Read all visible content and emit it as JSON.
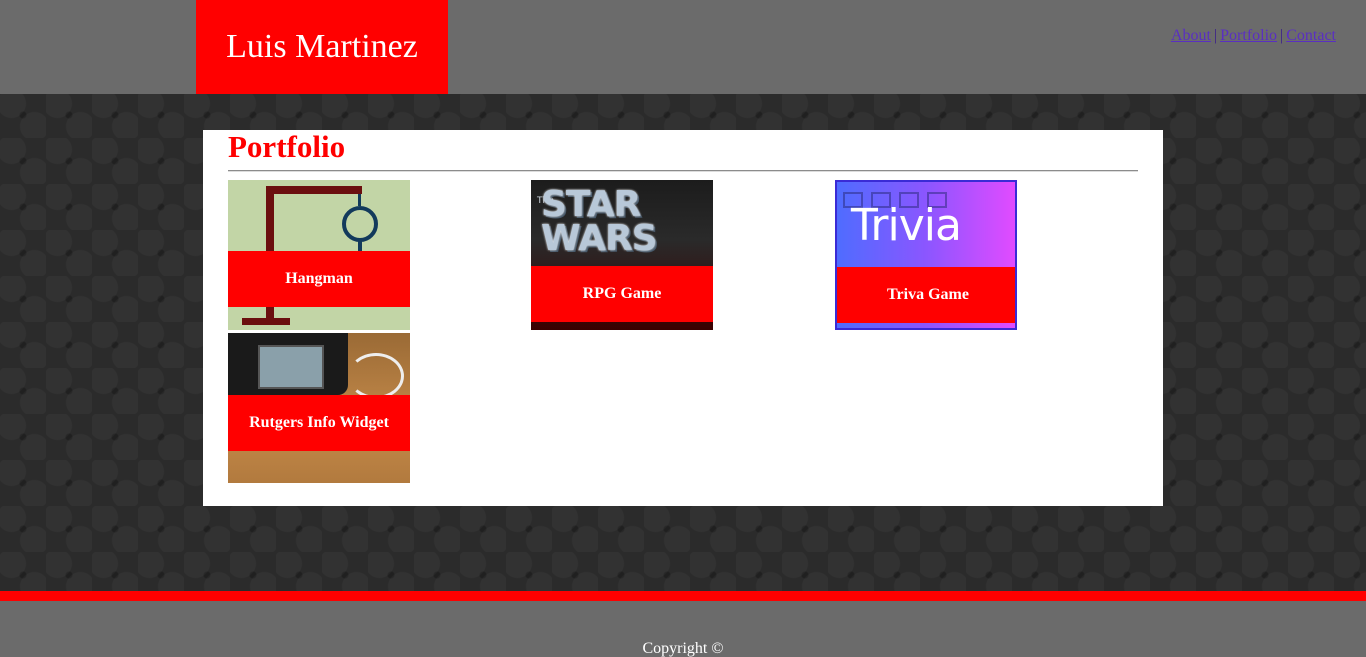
{
  "header": {
    "brand": "Luis Martinez",
    "nav": [
      {
        "label": "About"
      },
      {
        "label": "Portfolio"
      },
      {
        "label": "Contact"
      }
    ],
    "separator": "|"
  },
  "portfolio": {
    "title": "Portfolio",
    "items": [
      {
        "label": "Hangman",
        "thumbnail": "hangman-drawing"
      },
      {
        "label": "RPG Game",
        "thumbnail": "star-wars-logo",
        "thumbnail_text": "STAR WARS",
        "thumbnail_small_text": "The"
      },
      {
        "label": "Triva Game",
        "thumbnail": "trivia-screen",
        "thumbnail_text": "Trivia"
      },
      {
        "label": "Rutgers Info Widget",
        "thumbnail": "phone-with-earbuds"
      }
    ]
  },
  "footer": {
    "copyright": "Copyright ©"
  },
  "colors": {
    "accent": "#ff0000",
    "header_bg": "#6b6b6b",
    "page_bg": "#2b2b2b",
    "panel_bg": "#ffffff",
    "link": "#5a2fc2"
  }
}
